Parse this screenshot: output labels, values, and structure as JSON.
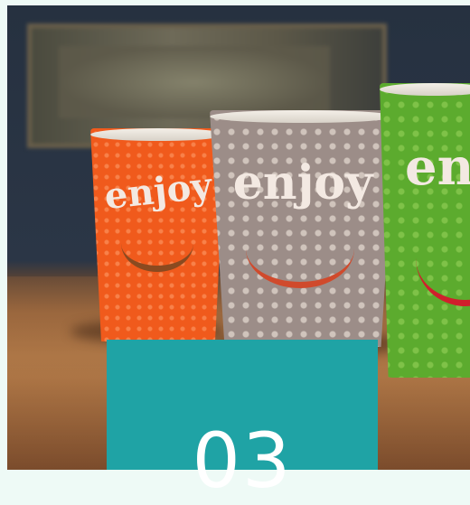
{
  "photo": {
    "subject": "three disposable coffee cups on a wooden table",
    "cups": [
      {
        "color": "#f05a1c",
        "text": "enjoy"
      },
      {
        "color": "#9c8d88",
        "text": "enjoy"
      },
      {
        "color": "#5cab2e",
        "text": "en"
      }
    ]
  },
  "overlay": {
    "color": "#1fa3a5",
    "number": "03"
  }
}
